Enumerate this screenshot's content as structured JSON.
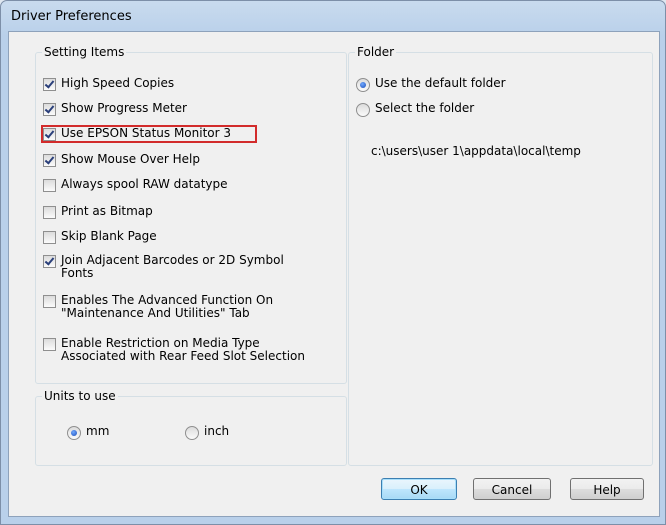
{
  "window": {
    "title": "Driver Preferences"
  },
  "setting_items": {
    "label": "Setting Items",
    "items": [
      {
        "label": "High Speed Copies",
        "checked": true
      },
      {
        "label": "Show Progress Meter",
        "checked": true
      },
      {
        "label": "Use EPSON Status Monitor 3",
        "checked": true
      },
      {
        "label": "Show Mouse Over Help",
        "checked": true
      },
      {
        "label": "Always spool RAW datatype",
        "checked": false
      },
      {
        "label": "Print as Bitmap",
        "checked": false
      },
      {
        "label": "Skip Blank Page",
        "checked": false
      },
      {
        "label_line1": "Join Adjacent Barcodes or 2D Symbol",
        "label_line2": "Fonts",
        "checked": true
      },
      {
        "label_line1": "Enables The Advanced Function On",
        "label_line2": "\"Maintenance And Utilities\" Tab",
        "checked": false
      },
      {
        "label_line1": "Enable Restriction on Media Type",
        "label_line2": "Associated with Rear Feed Slot Selection",
        "checked": false
      }
    ]
  },
  "units": {
    "label": "Units to use",
    "options": [
      {
        "label": "mm",
        "selected": true
      },
      {
        "label": "inch",
        "selected": false
      }
    ]
  },
  "folder": {
    "label": "Folder",
    "options": [
      {
        "label": "Use the default folder",
        "selected": true
      },
      {
        "label": "Select the folder",
        "selected": false
      }
    ],
    "path": "c:\\users\\user 1\\appdata\\local\\temp"
  },
  "buttons": {
    "ok": "OK",
    "cancel": "Cancel",
    "help": "Help"
  },
  "colors": {
    "highlight": "#d22b2b",
    "radio_selected": "#1c4db8",
    "check": "#2a3f7a"
  }
}
